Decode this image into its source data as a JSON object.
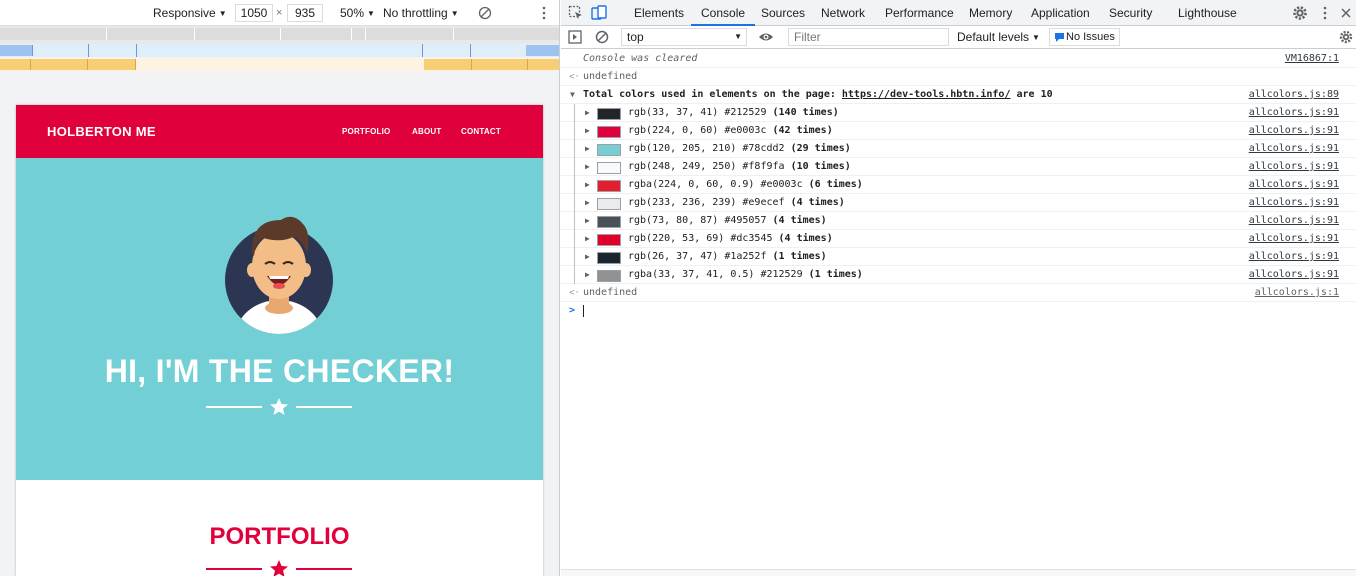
{
  "device_toolbar": {
    "mode": "Responsive",
    "width": "1050",
    "times": "×",
    "height": "935",
    "zoom": "50%",
    "throttling": "No throttling"
  },
  "site": {
    "brand": "HOLBERTON ME",
    "nav": [
      "PORTFOLIO",
      "ABOUT",
      "CONTACT"
    ],
    "hero_title": "HI, I'M THE CHECKER!",
    "section_title": "PORTFOLIO",
    "colors": {
      "primary": "#e0003c",
      "hero": "#73cfd6",
      "dark": "#212529"
    }
  },
  "devtools": {
    "tabs": [
      "Elements",
      "Console",
      "Sources",
      "Network",
      "Performance",
      "Memory",
      "Application",
      "Security",
      "Lighthouse"
    ],
    "active_tab": "Console",
    "context": "top",
    "filter_placeholder": "Filter",
    "levels": "Default levels",
    "issues": "No Issues"
  },
  "console": {
    "cleared": {
      "text": "Console was cleared",
      "source": "VM16867:1"
    },
    "undefined1": "undefined",
    "summary": {
      "prefix": "Total colors used in elements on the page: ",
      "url": "https://dev-tools.hbtn.info/",
      "suffix": " are 10",
      "source": "allcolors.js:89"
    },
    "colors": [
      {
        "label": "rgb(33, 37, 41) #212529",
        "count": "(140 times)",
        "swatch": "#212529",
        "source": "allcolors.js:91"
      },
      {
        "label": "rgb(224, 0, 60) #e0003c",
        "count": "(42 times)",
        "swatch": "#e0003c",
        "source": "allcolors.js:91"
      },
      {
        "label": "rgb(120, 205, 210) #78cdd2",
        "count": "(29 times)",
        "swatch": "#78cdd2",
        "source": "allcolors.js:91"
      },
      {
        "label": "rgb(248, 249, 250) #f8f9fa",
        "count": "(10 times)",
        "swatch": "#f8f9fa",
        "source": "allcolors.js:91"
      },
      {
        "label": "rgba(224, 0, 60, 0.9) #e0003c",
        "count": "(6 times)",
        "swatch": "#e41e2d",
        "source": "allcolors.js:91"
      },
      {
        "label": "rgb(233, 236, 239) #e9ecef",
        "count": "(4 times)",
        "swatch": "#e9ecef",
        "source": "allcolors.js:91"
      },
      {
        "label": "rgb(73, 80, 87) #495057",
        "count": "(4 times)",
        "swatch": "#495057",
        "source": "allcolors.js:91"
      },
      {
        "label": "rgb(220, 53, 69) #dc3545",
        "count": "(4 times)",
        "swatch": "#e2002a",
        "source": "allcolors.js:91"
      },
      {
        "label": "rgb(26, 37, 47) #1a252f",
        "count": "(1 times)",
        "swatch": "#1a252f",
        "source": "allcolors.js:91"
      },
      {
        "label": "rgba(33, 37, 41, 0.5) #212529",
        "count": "(1 times)",
        "swatch": "#909294",
        "source": "allcolors.js:91"
      }
    ],
    "undefined2": {
      "text": "undefined",
      "source": "allcolors.js:1"
    },
    "prompt": ">"
  }
}
